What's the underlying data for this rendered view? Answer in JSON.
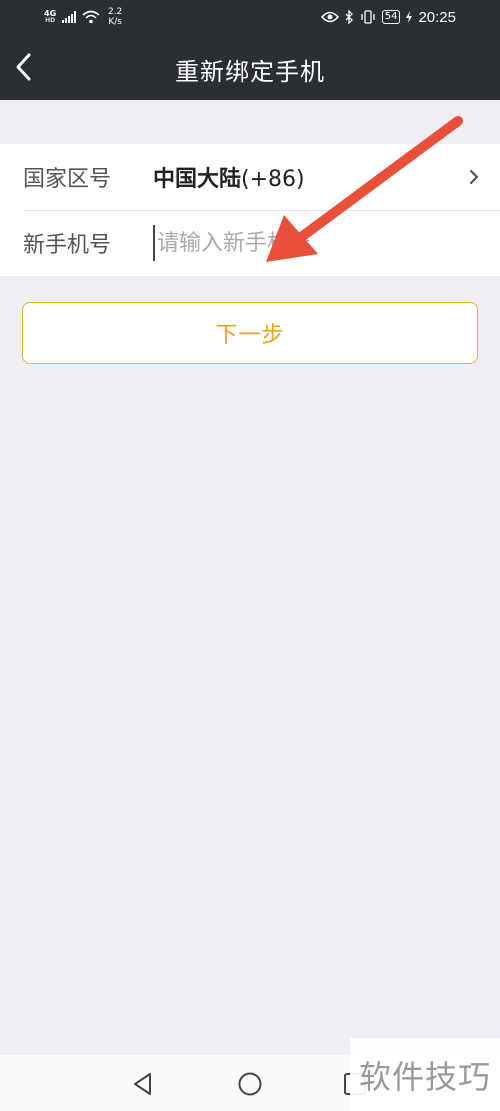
{
  "status_bar": {
    "network_type": "4G",
    "network_sub": "HD",
    "speed_top": "2.2",
    "speed_bottom": "K/s",
    "battery": "54",
    "time": "20:25"
  },
  "nav": {
    "title": "重新绑定手机",
    "back_icon": "chevron-left-icon"
  },
  "form": {
    "country_label": "国家区号",
    "country_name": "中国大陆",
    "country_code": "(+86)",
    "phone_label": "新手机号",
    "phone_placeholder": "请输入新手机号",
    "phone_value": ""
  },
  "next_button": {
    "label": "下一步"
  },
  "bottom_nav": {
    "icons": [
      "triangle-back-icon",
      "circle-home-icon",
      "square-recent-icon"
    ]
  },
  "watermark": {
    "text": "软件技巧"
  },
  "colors": {
    "header_bg": "#2b2e33",
    "page_bg": "#efeef4",
    "accent": "#e8a21e",
    "annotation_arrow": "#e8503a"
  }
}
